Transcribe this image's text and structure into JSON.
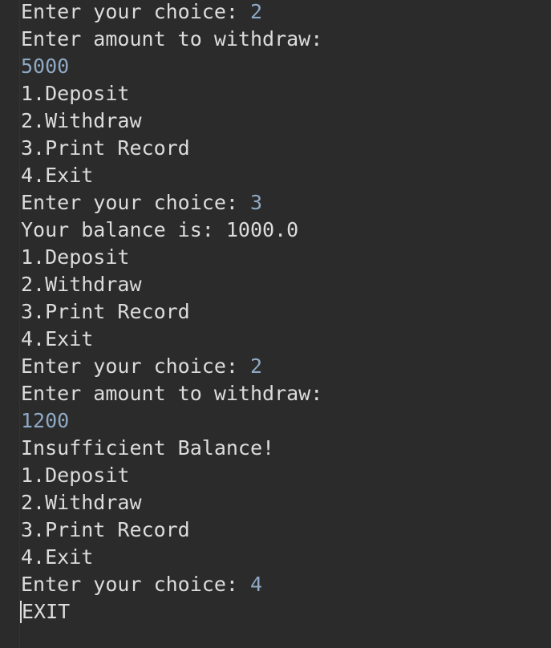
{
  "console": {
    "lines": [
      {
        "text": "Enter your choice: ",
        "input": "2"
      },
      {
        "text": "Enter amount to withdraw:",
        "input": ""
      },
      {
        "text": "",
        "input": "5000"
      },
      {
        "text": "1.Deposit",
        "input": ""
      },
      {
        "text": "2.Withdraw",
        "input": ""
      },
      {
        "text": "3.Print Record",
        "input": ""
      },
      {
        "text": "4.Exit",
        "input": ""
      },
      {
        "text": "Enter your choice: ",
        "input": "3"
      },
      {
        "text": "Your balance is: 1000.0",
        "input": ""
      },
      {
        "text": "1.Deposit",
        "input": ""
      },
      {
        "text": "2.Withdraw",
        "input": ""
      },
      {
        "text": "3.Print Record",
        "input": ""
      },
      {
        "text": "4.Exit",
        "input": ""
      },
      {
        "text": "Enter your choice: ",
        "input": "2"
      },
      {
        "text": "Enter amount to withdraw:",
        "input": ""
      },
      {
        "text": "",
        "input": "1200"
      },
      {
        "text": "Insufficient Balance!",
        "input": ""
      },
      {
        "text": "1.Deposit",
        "input": ""
      },
      {
        "text": "2.Withdraw",
        "input": ""
      },
      {
        "text": "3.Print Record",
        "input": ""
      },
      {
        "text": "4.Exit",
        "input": ""
      },
      {
        "text": "Enter your choice: ",
        "input": "4"
      },
      {
        "text": "EXIT",
        "input": ""
      }
    ]
  },
  "colors": {
    "background": "#2b2b2b",
    "output_text": "#dcdcdc",
    "user_input": "#8fa9c5"
  }
}
